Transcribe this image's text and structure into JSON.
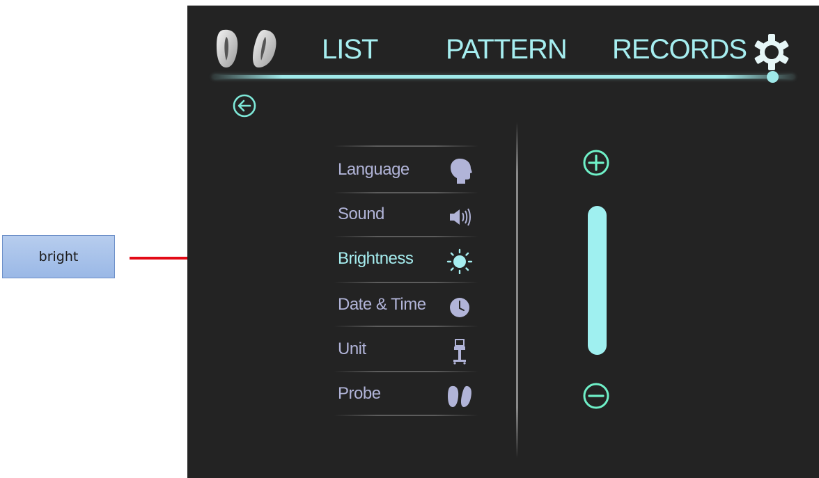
{
  "callout": {
    "label": "bright"
  },
  "header": {
    "tabs": [
      {
        "label": "LIST"
      },
      {
        "label": "PATTERN"
      },
      {
        "label": "RECORDS"
      }
    ],
    "probe_icon": "probe-pair-icon",
    "settings_icon": "gear-icon"
  },
  "back_icon": "back-arrow-icon",
  "settings_menu": {
    "items": [
      {
        "label": "Language",
        "icon": "head-profile-icon",
        "active": false
      },
      {
        "label": "Sound",
        "icon": "speaker-icon",
        "active": false
      },
      {
        "label": "Brightness",
        "icon": "sun-icon",
        "active": true
      },
      {
        "label": "Date & Time",
        "icon": "clock-icon",
        "active": false
      },
      {
        "label": "Unit",
        "icon": "device-cart-icon",
        "active": false
      },
      {
        "label": "Probe",
        "icon": "probe-icon",
        "active": false
      }
    ]
  },
  "brightness_control": {
    "increase_icon": "plus-icon",
    "decrease_icon": "minus-icon",
    "level_fraction": 1.0
  },
  "colors": {
    "accent": "#9fe9e9",
    "menu_text": "#b1b4d8",
    "background": "#232323",
    "callout_line": "#e30a16",
    "callout_fill": "#a9c3ea"
  }
}
